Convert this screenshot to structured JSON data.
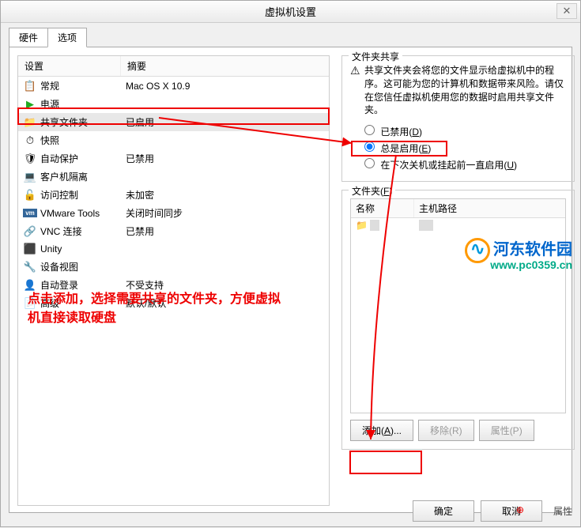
{
  "title": "虚拟机设置",
  "tabs": {
    "hardware": "硬件",
    "options": "选项"
  },
  "list": {
    "header": {
      "col1": "设置",
      "col2": "摘要"
    },
    "rows": [
      {
        "icon": "📋",
        "label": "常规",
        "summary": "Mac OS X 10.9"
      },
      {
        "icon": "▶",
        "label": "电源",
        "summary": ""
      },
      {
        "icon": "📁",
        "label": "共享文件夹",
        "summary": "已启用"
      },
      {
        "icon": "⏱",
        "label": "快照",
        "summary": ""
      },
      {
        "icon": "🛡",
        "label": "自动保护",
        "summary": "已禁用"
      },
      {
        "icon": "💻",
        "label": "客户机隔离",
        "summary": ""
      },
      {
        "icon": "🔓",
        "label": "访问控制",
        "summary": "未加密"
      },
      {
        "icon": "vm",
        "label": "VMware Tools",
        "summary": "关闭时间同步"
      },
      {
        "icon": "🔗",
        "label": "VNC 连接",
        "summary": "已禁用"
      },
      {
        "icon": "⬛",
        "label": "Unity",
        "summary": ""
      },
      {
        "icon": "🔧",
        "label": "设备视图",
        "summary": ""
      },
      {
        "icon": "👤",
        "label": "自动登录",
        "summary": "不受支持"
      },
      {
        "icon": "📄",
        "label": "高级",
        "summary": "默认/默认"
      }
    ]
  },
  "instruction": "点击添加，选择需要共享的文件夹，方便虚拟机直接读取硬盘",
  "right": {
    "sharing": {
      "title": "文件夹共享",
      "warning": "共享文件夹会将您的文件显示给虚拟机中的程序。这可能为您的计算机和数据带来风险。请仅在您信任虚拟机使用您的数据时启用共享文件夹。",
      "opt_disabled": "已禁用(D)",
      "opt_always": "总是启用(E)",
      "opt_next": "在下次关机或挂起前一直启用(U)"
    },
    "folders": {
      "title": "文件夹(F)",
      "col_name": "名称",
      "col_path": "主机路径"
    },
    "buttons": {
      "add": "添加(A)...",
      "remove": "移除(R)",
      "props": "属性(P)"
    }
  },
  "dialog_buttons": {
    "ok": "确定",
    "cancel": "取消",
    "advanced": "属性"
  },
  "watermark": {
    "name": "河东软件园",
    "url": "www.pc0359.cn"
  }
}
